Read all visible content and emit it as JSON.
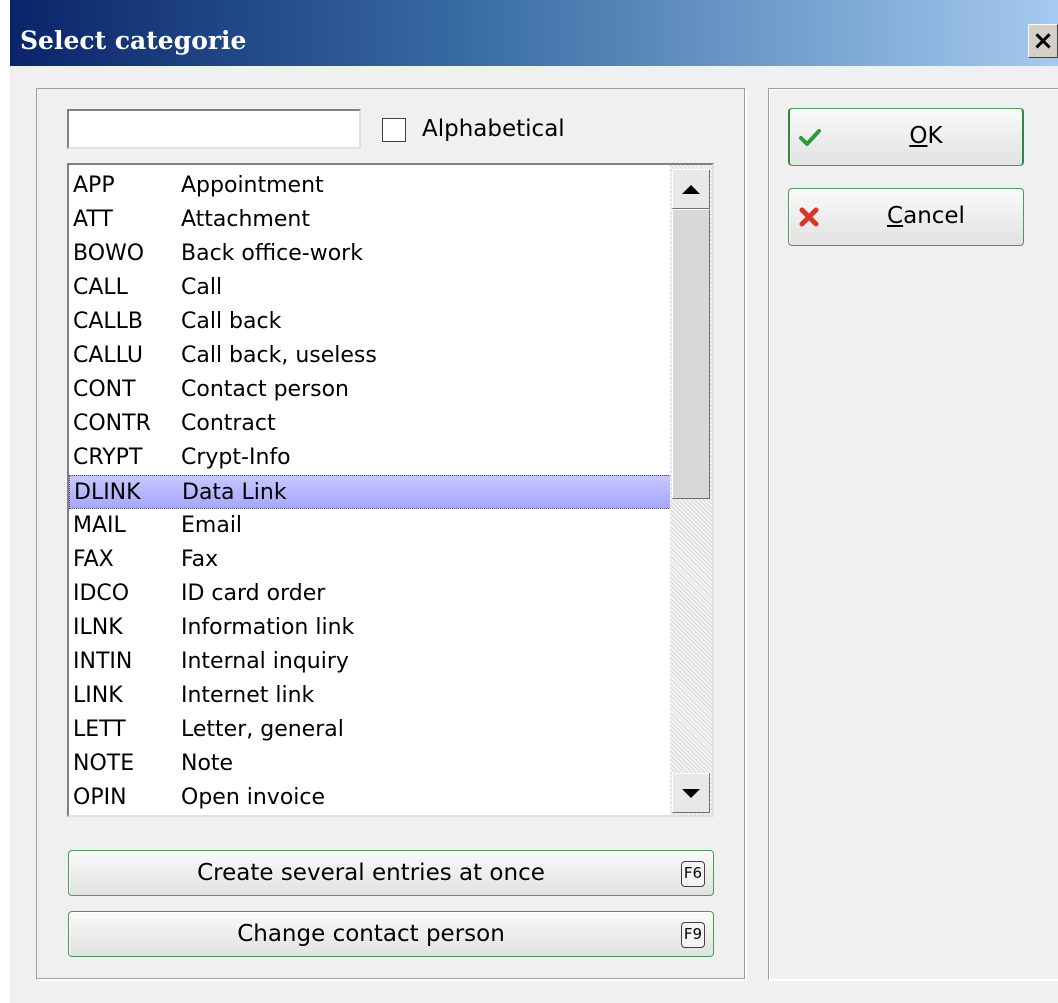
{
  "window": {
    "title": "Select categorie",
    "close_glyph": "×"
  },
  "filter": {
    "search_value": "",
    "alphabetical_label": "Alphabetical",
    "alphabetical_checked": false
  },
  "list": {
    "selected_index": 9,
    "items": [
      {
        "code": "APP",
        "desc": "Appointment"
      },
      {
        "code": "ATT",
        "desc": "Attachment"
      },
      {
        "code": "BOWO",
        "desc": "Back office-work"
      },
      {
        "code": "CALL",
        "desc": "Call"
      },
      {
        "code": "CALLB",
        "desc": "Call back"
      },
      {
        "code": "CALLU",
        "desc": "Call back, useless"
      },
      {
        "code": "CONT",
        "desc": "Contact person"
      },
      {
        "code": "CONTR",
        "desc": "Contract"
      },
      {
        "code": "CRYPT",
        "desc": "Crypt-Info"
      },
      {
        "code": "DLINK",
        "desc": "Data Link"
      },
      {
        "code": "MAIL",
        "desc": "Email"
      },
      {
        "code": "FAX",
        "desc": "Fax"
      },
      {
        "code": "IDCO",
        "desc": "ID card order"
      },
      {
        "code": "ILNK",
        "desc": "Information link"
      },
      {
        "code": "INTIN",
        "desc": "Internal inquiry"
      },
      {
        "code": "LINK",
        "desc": "Internet link"
      },
      {
        "code": "LETT",
        "desc": "Letter, general"
      },
      {
        "code": "NOTE",
        "desc": "Note"
      },
      {
        "code": "OPIN",
        "desc": "Open invoice"
      }
    ]
  },
  "actions": {
    "create_several": {
      "label": "Create several entries at once",
      "shortcut": "F6"
    },
    "change_contact": {
      "label": "Change contact person",
      "shortcut": "F9"
    },
    "ok": {
      "mnemonic": "O",
      "rest": "K",
      "icon": "checkmark-icon"
    },
    "cancel": {
      "mnemonic": "C",
      "rest": "ancel",
      "icon": "cross-icon"
    }
  },
  "colors": {
    "selection": "#a6a6ff",
    "button_border": "#4d9a57",
    "ok_icon": "#2e9c3a",
    "cancel_icon": "#d9352a"
  }
}
